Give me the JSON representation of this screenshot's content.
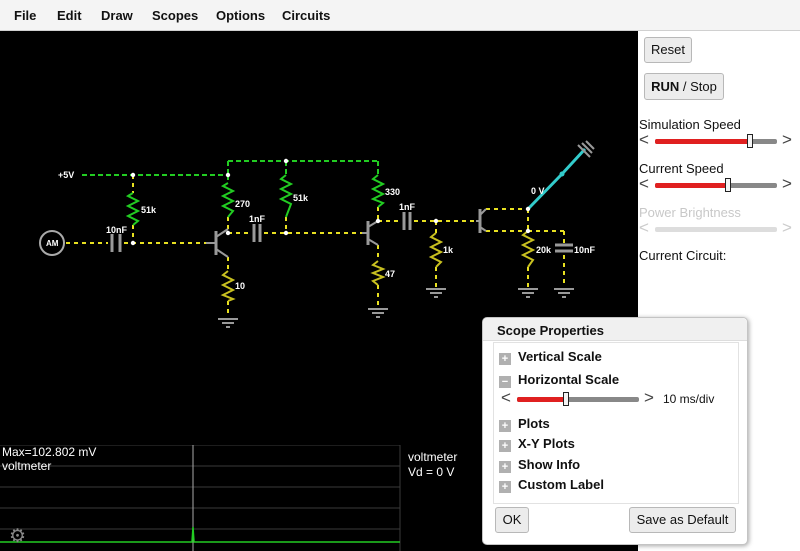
{
  "menu": [
    "File",
    "Edit",
    "Draw",
    "Scopes",
    "Options",
    "Circuits"
  ],
  "circuit": {
    "labels": {
      "supply": "+5V",
      "ammeter": "AM",
      "r1": "51k",
      "r2": "270",
      "r3": "51k",
      "r4": "330",
      "r5": "10",
      "r6": "47",
      "r7": "1k",
      "r8": "20k",
      "c1": "10nF",
      "c2": "1nF",
      "c3": "1nF",
      "c4": "10nF",
      "probe": "0 V"
    }
  },
  "scope": {
    "max_text": "Max=102.802 mV",
    "name_left": "voltmeter",
    "name_right": "voltmeter",
    "vd_text": "Vd = 0 V"
  },
  "sidebar": {
    "reset_label": "Reset",
    "run_label": "RUN",
    "stop_label": "/ Stop",
    "sim_speed_label": "Simulation Speed",
    "current_speed_label": "Current Speed",
    "power_brightness_label": "Power Brightness",
    "current_circuit_label": "Current Circuit:",
    "sim_speed_level": 0.78,
    "current_speed_level": 0.6,
    "power_brightness_level": 0.5
  },
  "dialog": {
    "title": "Scope Properties",
    "sections": [
      "Vertical Scale",
      "Horizontal Scale",
      "Plots",
      "X-Y Plots",
      "Show Info",
      "Custom Label"
    ],
    "hscale_value": "10 ms/div",
    "hscale_level": 0.4,
    "ok_label": "OK",
    "save_default_label": "Save as Default"
  },
  "colors": {
    "wire_active": "#22cc22",
    "component": "#999999",
    "probe": "#33cccc",
    "slider_fill": "#e02020"
  }
}
